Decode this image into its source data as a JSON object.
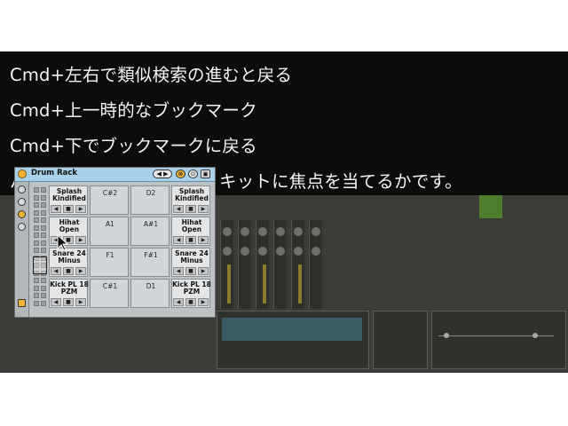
{
  "captions": [
    "Cmd+左右で類似検索の進むと戻る",
    "Cmd+上一時的なブックマーク",
    "Cmd+下でブックマークに戻る",
    "パッドに焦点を当てるか、キットに焦点を当てるかです。"
  ],
  "device": {
    "title": "Drum Rack",
    "title_icons": [
      "arrow-icon",
      "save-icon"
    ],
    "pads": [
      [
        {
          "name": "Splash Kindified",
          "filled": true
        },
        {
          "note": "C#2"
        },
        {
          "note": "D2"
        },
        {
          "name": "Splash Kindified",
          "filled": true
        }
      ],
      [
        {
          "name": "Hihat Open",
          "filled": true
        },
        {
          "note": "A1"
        },
        {
          "note": "A#1"
        },
        {
          "name": "Hihat Open",
          "filled": true
        }
      ],
      [
        {
          "name": "Snare 24 Minus",
          "filled": true
        },
        {
          "note": "F1"
        },
        {
          "note": "F#1"
        },
        {
          "name": "Snare 24 Minus",
          "filled": true
        }
      ],
      [
        {
          "name": "Kick PL 18 PZM",
          "filled": true
        },
        {
          "note": "C#1"
        },
        {
          "note": "D1"
        },
        {
          "name": "Kick PL 18 PZM",
          "filled": true
        }
      ]
    ],
    "pad_controls": {
      "left": "◀",
      "lock": "🔒",
      "right": "▶"
    }
  },
  "colors": {
    "title_bar": "#a9d0ea",
    "power": "#f2b233",
    "caption_bg": "#060606"
  }
}
